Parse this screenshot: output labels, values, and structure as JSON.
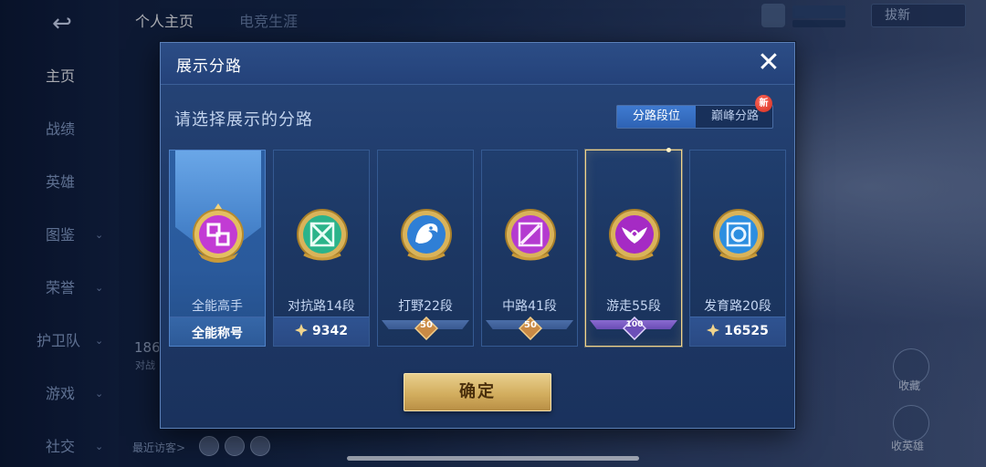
{
  "background": {
    "sidebar": {
      "back_symbol": "↩",
      "items": [
        {
          "label": "主页",
          "active": true
        },
        {
          "label": "战绩"
        },
        {
          "label": "英雄"
        },
        {
          "label": "图鉴",
          "chevron": "⌄"
        },
        {
          "label": "荣誉",
          "chevron": "⌄"
        },
        {
          "label": "护卫队",
          "chevron": "⌄"
        },
        {
          "label": "游戏",
          "chevron": "⌄"
        },
        {
          "label": "社交",
          "chevron": "⌄"
        }
      ]
    },
    "top_tabs": [
      {
        "label": "个人主页",
        "active": true
      },
      {
        "label": "电竞生涯"
      }
    ],
    "top_right_button": "拔新",
    "stat_number": "186",
    "stat_caption": "对战",
    "recent_visitors_label": "最近访客>",
    "right_labels": [
      "收藏",
      "收英雄"
    ]
  },
  "dialog": {
    "title": "展示分路",
    "close_icon": "✕",
    "prompt": "请选择展示的分路",
    "segmented": {
      "options": [
        "分路段位",
        "巅峰分路"
      ],
      "active_index": 0,
      "new_badge": "新"
    },
    "cards": [
      {
        "label": "全能高手",
        "footer_text": "全能称号",
        "footer_type": "text",
        "emblem_color": "#c23bd4",
        "emblem_icon": "squares-icon"
      },
      {
        "label": "对抗路14段",
        "footer_score": "9342",
        "footer_type": "score",
        "emblem_color": "#2bb38a",
        "emblem_icon": "swords-icon"
      },
      {
        "label": "打野22段",
        "footer_badge": "50",
        "footer_type": "badge",
        "emblem_color": "#2f7fd6",
        "emblem_icon": "dragon-icon"
      },
      {
        "label": "中路41段",
        "footer_badge": "50",
        "footer_type": "badge",
        "emblem_color": "#b43ad0",
        "emblem_icon": "slash-icon"
      },
      {
        "label": "游走55段",
        "footer_badge": "100",
        "footer_type": "badge",
        "emblem_color": "#a52bc4",
        "emblem_icon": "wings-icon",
        "selected": true
      },
      {
        "label": "发育路20段",
        "footer_score": "16525",
        "footer_type": "score",
        "emblem_color": "#2c8ee0",
        "emblem_icon": "target-icon"
      }
    ],
    "confirm_label": "确定"
  }
}
